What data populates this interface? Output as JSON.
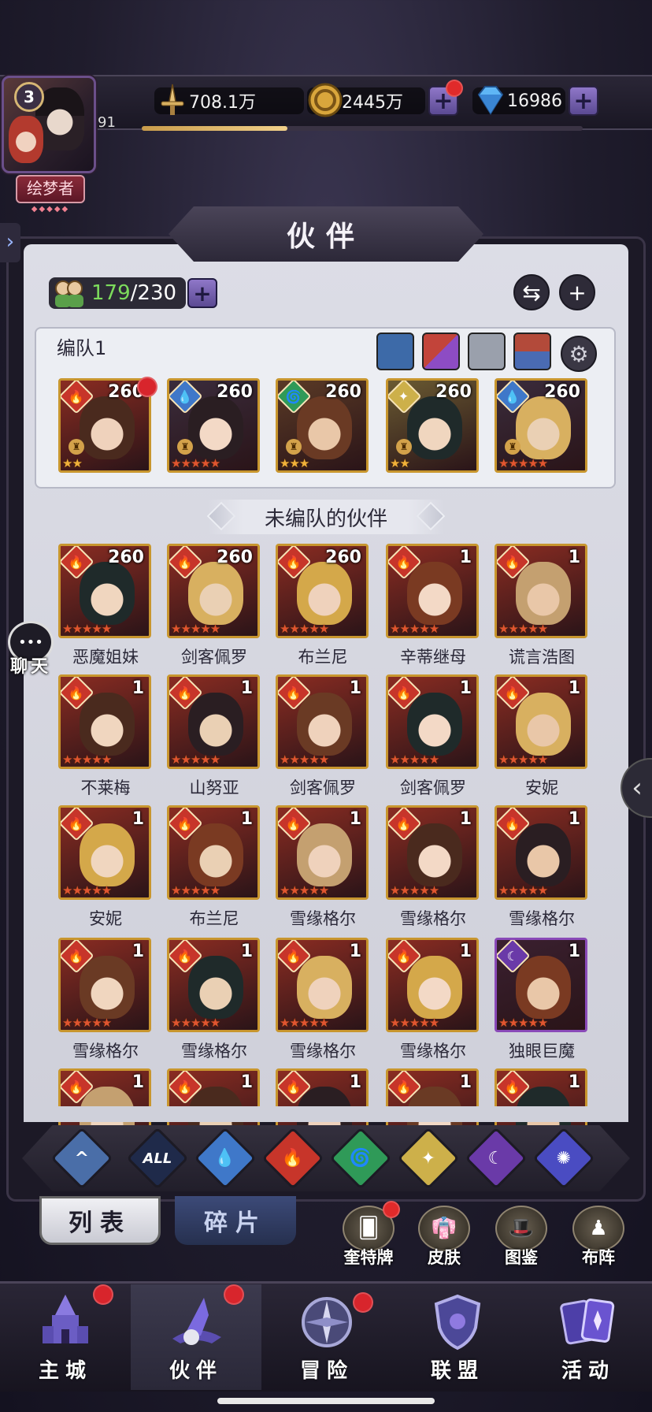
{
  "player": {
    "level": "3",
    "exp_level": "91",
    "exp_progress": 0.33,
    "title": "绘梦者"
  },
  "resources": {
    "power": "708.1万",
    "gold": "2445万",
    "diamonds": "16986"
  },
  "panel": {
    "title": "伙伴",
    "hero_count_current": "179",
    "hero_count_max": "/230"
  },
  "team": {
    "label": "编队1",
    "members": [
      {
        "level": "260",
        "element": "fire",
        "stars": 2,
        "star_color": "gold"
      },
      {
        "level": "260",
        "element": "water",
        "stars": 5,
        "star_color": "red"
      },
      {
        "level": "260",
        "element": "wind",
        "stars": 3,
        "star_color": "gold"
      },
      {
        "level": "260",
        "element": "light",
        "stars": 2,
        "star_color": "gold"
      },
      {
        "level": "260",
        "element": "water",
        "stars": 5,
        "star_color": "red"
      }
    ]
  },
  "unassigned": {
    "label": "未编队的伙伴",
    "heroes": [
      {
        "name": "恶魔姐妹",
        "level": "260",
        "element": "fire"
      },
      {
        "name": "剑客佩罗",
        "level": "260",
        "element": "fire"
      },
      {
        "name": "布兰尼",
        "level": "260",
        "element": "fire"
      },
      {
        "name": "辛蒂继母",
        "level": "1",
        "element": "fire"
      },
      {
        "name": "谎言浩图",
        "level": "1",
        "element": "fire"
      },
      {
        "name": "不莱梅",
        "level": "1",
        "element": "fire"
      },
      {
        "name": "山努亚",
        "level": "1",
        "element": "fire"
      },
      {
        "name": "剑客佩罗",
        "level": "1",
        "element": "fire"
      },
      {
        "name": "剑客佩罗",
        "level": "1",
        "element": "fire"
      },
      {
        "name": "安妮",
        "level": "1",
        "element": "fire"
      },
      {
        "name": "安妮",
        "level": "1",
        "element": "fire"
      },
      {
        "name": "布兰尼",
        "level": "1",
        "element": "fire"
      },
      {
        "name": "雪缘格尔",
        "level": "1",
        "element": "fire"
      },
      {
        "name": "雪缘格尔",
        "level": "1",
        "element": "fire"
      },
      {
        "name": "雪缘格尔",
        "level": "1",
        "element": "fire"
      },
      {
        "name": "雪缘格尔",
        "level": "1",
        "element": "fire"
      },
      {
        "name": "雪缘格尔",
        "level": "1",
        "element": "fire"
      },
      {
        "name": "雪缘格尔",
        "level": "1",
        "element": "fire"
      },
      {
        "name": "雪缘格尔",
        "level": "1",
        "element": "fire"
      },
      {
        "name": "独眼巨魔",
        "level": "1",
        "element": "dark"
      },
      {
        "name": "",
        "level": "1",
        "element": "fire"
      },
      {
        "name": "",
        "level": "1",
        "element": "fire"
      },
      {
        "name": "",
        "level": "1",
        "element": "fire"
      },
      {
        "name": "",
        "level": "1",
        "element": "fire"
      },
      {
        "name": "",
        "level": "1",
        "element": "fire"
      }
    ]
  },
  "filters": [
    "all-elements",
    "ALL",
    "water",
    "fire",
    "wind",
    "light",
    "dark",
    "cosmic"
  ],
  "sub_tabs": {
    "list": "列表",
    "shards": "碎片"
  },
  "shortcuts": {
    "cards": "奎特牌",
    "skins": "皮肤",
    "codex": "图鉴",
    "formation": "布阵"
  },
  "chat_label": "聊天",
  "nav": {
    "city": "主城",
    "partners": "伙伴",
    "adventure": "冒险",
    "alliance": "联盟",
    "events": "活动"
  },
  "colors": {
    "fire": "#c7352a",
    "water": "#3f78c9",
    "wind": "#2f9a58",
    "light": "#cdb04a",
    "dark": "#6a3aa8",
    "cosmic": "#4a4cc2",
    "accent_green": "#7ddc5c",
    "badge_red": "#d8252c"
  }
}
